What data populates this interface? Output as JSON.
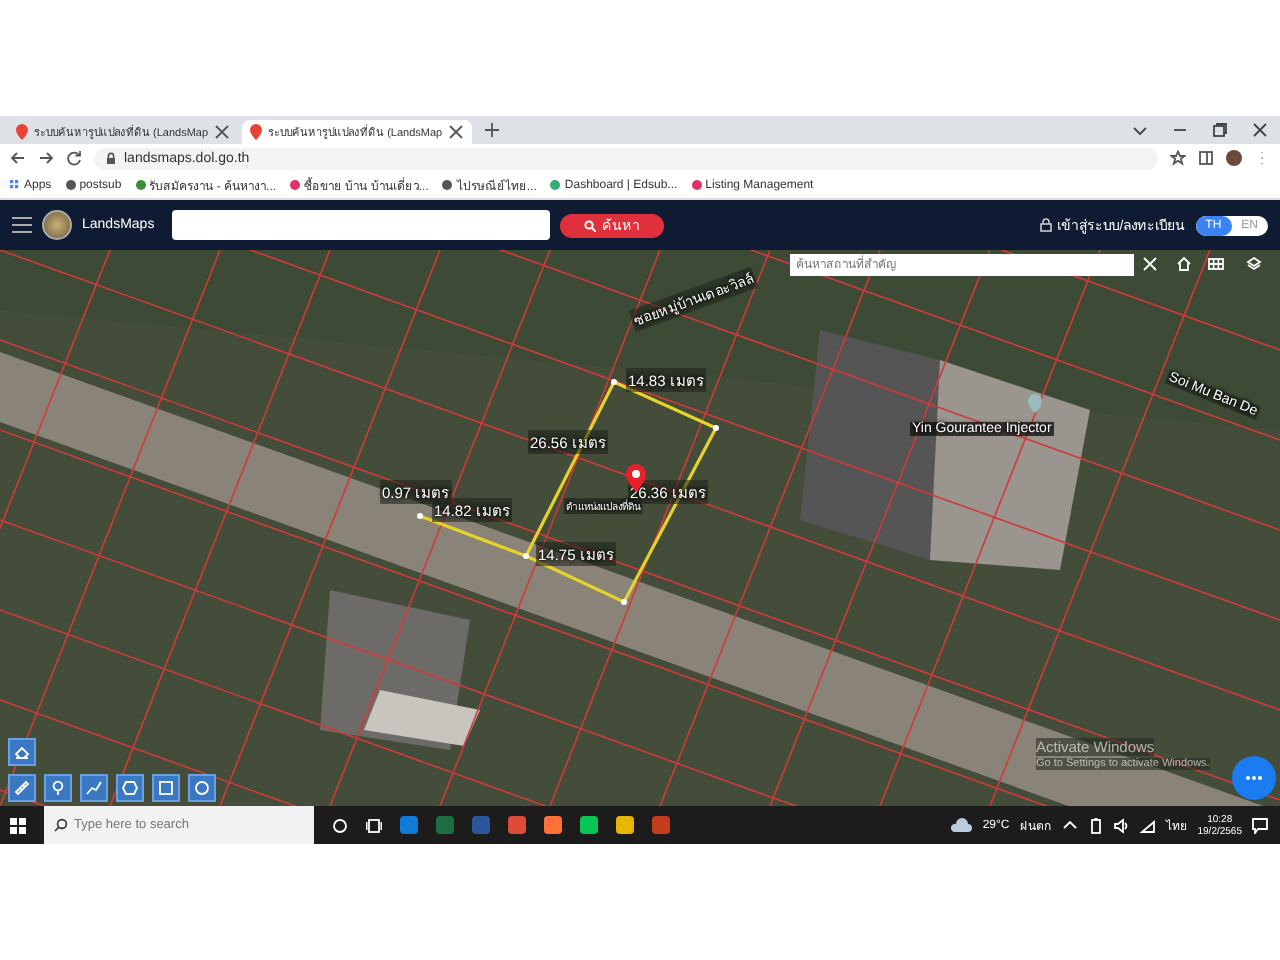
{
  "browser": {
    "tabs": [
      {
        "title": "ระบบค้นหารูปแปลงที่ดิน (LandsMap",
        "selected": false
      },
      {
        "title": "ระบบค้นหารูปแปลงที่ดิน (LandsMap",
        "selected": true
      }
    ],
    "url": "landsmaps.dol.go.th",
    "bookmarks": [
      "Apps",
      "postsub",
      "รับสมัครงาน - ค้นหางา...",
      "ซื้อขาย บ้าน บ้านเดี่ยว...",
      "ไปรษณีย์ไทย...",
      "Dashboard | Edsub...",
      "Listing Management"
    ]
  },
  "header": {
    "logo": "LandsMaps",
    "search_button": "ค้นหา",
    "login": "เข้าสู่ระบบ/ลงทะเบียน",
    "languages": [
      {
        "label": "TH",
        "selected": true
      },
      {
        "label": "EN",
        "selected": false
      }
    ]
  },
  "map": {
    "search": {
      "placeholder": "ค้นหาสถานที่สำคัญ"
    },
    "streets": [
      "ซอยหมู่บ้านเดอะวิลล์",
      "Soi Mu Ban De"
    ],
    "measurements": [
      "14.83 เมตร",
      "26.56 เมตร",
      "26.36 เมตร",
      "0.97 เมตร",
      "14.82 เมตร",
      "14.75 เมตร"
    ],
    "pin_label": "ตำแหน่งแปลงที่ดิน",
    "place": "Yin Gourantee Injector",
    "notice": [
      "Activate Windows",
      "Go to Settings to activate Windows."
    ]
  },
  "taskbar": {
    "search": {
      "placeholder": "Type here to search"
    },
    "temperature": "29°C",
    "weather": "ฝนตก",
    "language": "ไทย",
    "time": "10:28",
    "date": "19/2/2565"
  }
}
